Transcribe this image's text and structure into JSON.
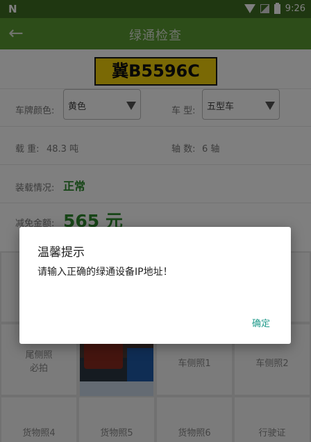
{
  "status_bar": {
    "left_icon": "N",
    "time": "9:26",
    "icons": [
      "wifi-icon",
      "signal-off-icon",
      "battery-icon"
    ]
  },
  "app_bar": {
    "back_icon": "←",
    "title": "绿通检查"
  },
  "plate": {
    "number": "冀B5596C",
    "color": "#f4d20b"
  },
  "form": {
    "plate_color": {
      "label": "车牌颜色:",
      "value": "黄色"
    },
    "vehicle_type": {
      "label": "车 型:",
      "value": "五型车"
    },
    "load": {
      "label": "载 重:",
      "value": "48.3 吨"
    },
    "axles": {
      "label": "轴 数:",
      "value": "6 轴"
    },
    "cargo_status": {
      "label": "装载情况:",
      "value": "正常"
    },
    "exemption": {
      "label": "减免金额:",
      "value": "565 元"
    }
  },
  "photos": {
    "tail": "尾侧照\n必拍",
    "side1": "车侧照1",
    "side2": "车侧照2",
    "cargo4": "货物照4",
    "cargo5": "货物照5",
    "cargo6": "货物照6",
    "license": "行驶证"
  },
  "dialog": {
    "title": "温馨提示",
    "message": "请输入正确的绿通设备IP地址！",
    "confirm": "确定"
  },
  "colors": {
    "primary": "#5a9b33",
    "status": "#3e6e22",
    "accent_green": "#2e8b2e",
    "dialog_button": "#1f9a8a"
  }
}
